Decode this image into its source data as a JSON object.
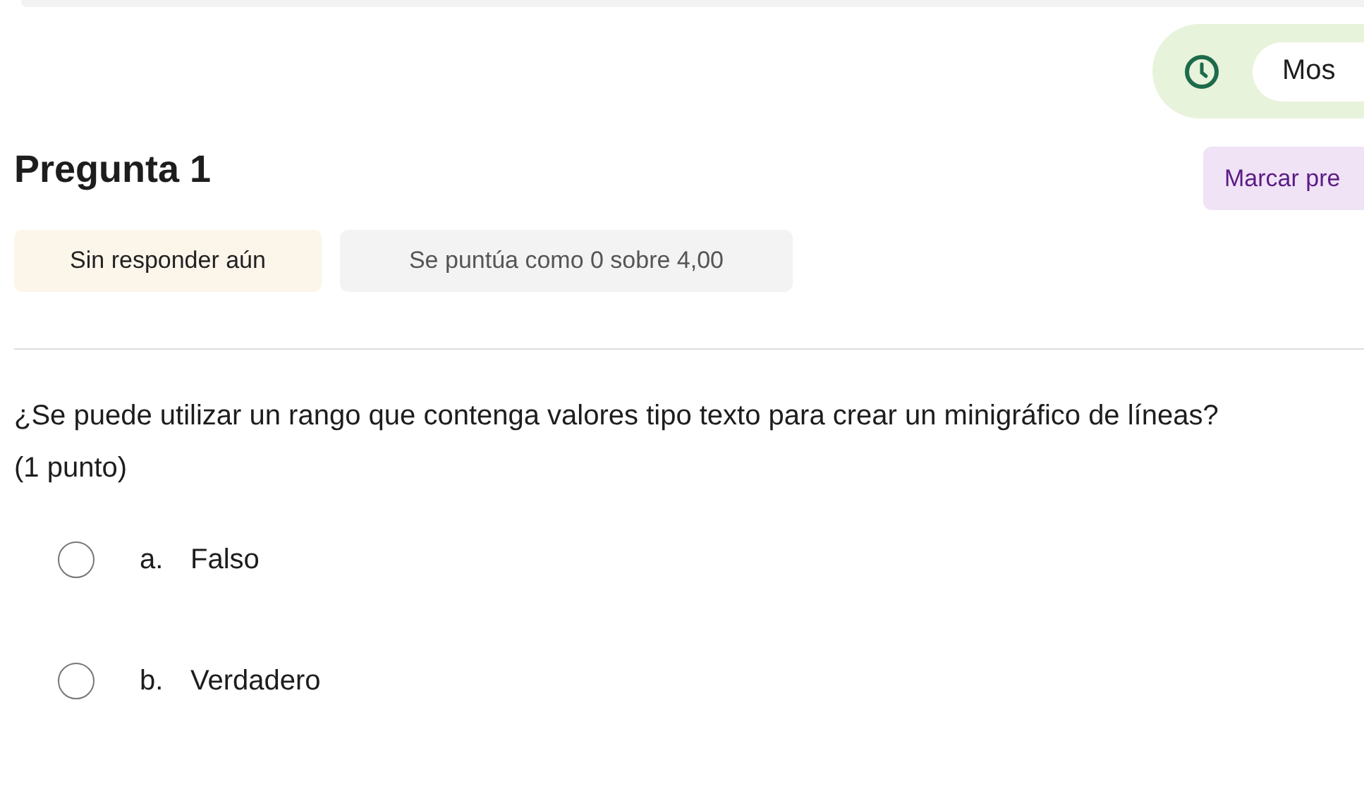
{
  "timer": {
    "label": "Mos"
  },
  "question": {
    "title": "Pregunta 1",
    "flag_button": "Marcar pre",
    "status": "Sin responder aún",
    "grade": "Se puntúa como 0 sobre 4,00",
    "text": "¿Se puede utilizar un rango que contenga valores tipo texto para crear un minigráfico de líneas?",
    "points": "(1 punto)"
  },
  "options": [
    {
      "letter": "a.",
      "label": "Falso",
      "selected": false
    },
    {
      "letter": "b.",
      "label": "Verdadero",
      "selected": false
    }
  ]
}
